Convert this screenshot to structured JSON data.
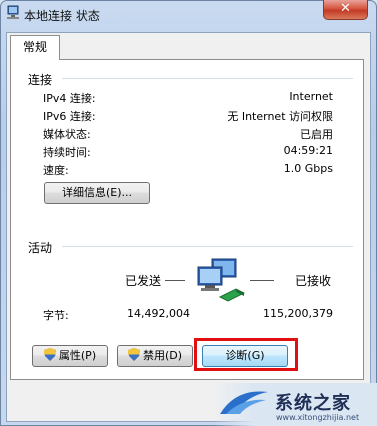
{
  "window": {
    "title": "本地连接 状态",
    "close_glyph": "✕"
  },
  "tabs": [
    {
      "label": "常规"
    }
  ],
  "connection": {
    "heading": "连接",
    "rows": [
      {
        "label": "IPv4 连接:",
        "value": "Internet"
      },
      {
        "label": "IPv6 连接:",
        "value": "无 Internet 访问权限"
      },
      {
        "label": "媒体状态:",
        "value": "已启用"
      },
      {
        "label": "持续时间:",
        "value": "04:59:21"
      },
      {
        "label": "速度:",
        "value": "1.0 Gbps"
      }
    ],
    "details_button": "详细信息(E)..."
  },
  "activity": {
    "heading": "活动",
    "sent_label": "已发送",
    "received_label": "已接收",
    "bytes_label": "字节:",
    "bytes_sent": "14,492,004",
    "bytes_received": "115,200,379"
  },
  "buttons": {
    "properties": "属性(P)",
    "disable": "禁用(D)",
    "diagnose": "诊断(G)"
  },
  "watermark": {
    "text": "系统之家",
    "url": "www.xitongzhijia.net"
  },
  "colors": {
    "highlight_border": "#e01010",
    "close_button": "#c23a25"
  }
}
